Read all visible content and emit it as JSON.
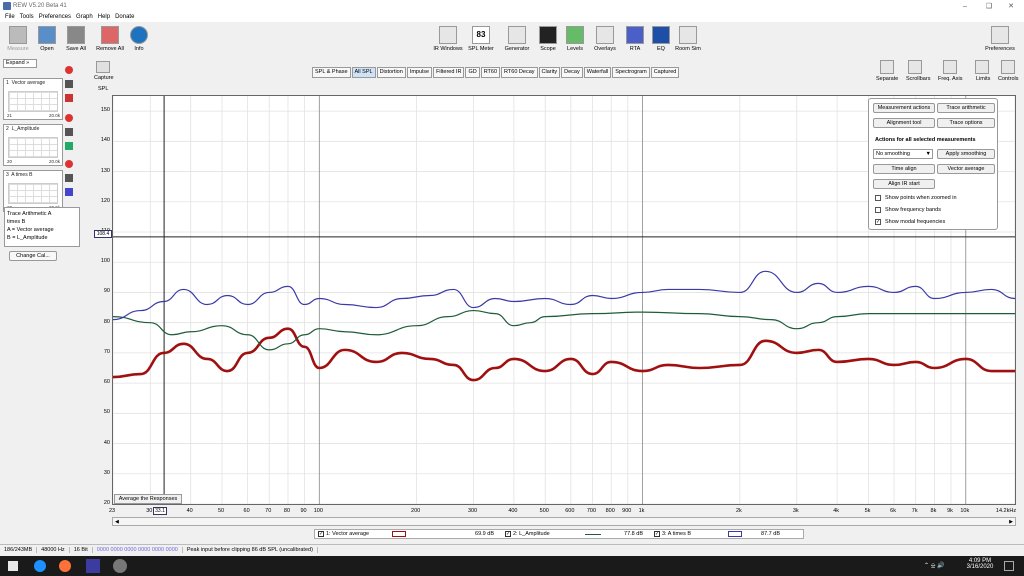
{
  "window": {
    "title": "REW V5.20 Beta 41"
  },
  "menu": [
    "File",
    "Tools",
    "Preferences",
    "Graph",
    "Help",
    "Donate"
  ],
  "toolbar": {
    "left": [
      "Measure",
      "Open",
      "Save All",
      "Remove All",
      "Info"
    ],
    "center": [
      "IR Windows",
      "SPL Meter",
      "Generator",
      "Scope",
      "Levels",
      "Overlays",
      "RTA",
      "EQ",
      "Room Sim"
    ],
    "spl_value": "83",
    "spl_tag": "dB SPL",
    "right": "Preferences"
  },
  "left_panel": {
    "expand": "Expand",
    "measurements": [
      {
        "num": "1",
        "name": "Vector average",
        "axis_left": "21",
        "axis_right": "20.0k"
      },
      {
        "num": "2",
        "name": "L_Amplitude",
        "axis_left": "20",
        "axis_right": "20.0k"
      },
      {
        "num": "3",
        "name": "A times B",
        "axis_left": "20",
        "axis_right": "20.0k"
      }
    ],
    "notes": [
      "Trace Arithmetic A",
      "times B",
      "A = Vector average",
      "B = L_Amplitude"
    ],
    "change_cal": "Change Cal..."
  },
  "capture": "Capture",
  "spl_axis_title": "SPL",
  "graph_tabs": [
    "SPL & Phase",
    "All SPL",
    "Distortion",
    "Impulse",
    "Filtered IR",
    "GD",
    "RT60",
    "RT60 Decay",
    "Clarity",
    "Decay",
    "Waterfall",
    "Spectrogram",
    "Captured"
  ],
  "active_tab": "All SPL",
  "right_tools": [
    "Separate",
    "Scrollbars",
    "Freq. Axis",
    "Limits",
    "Controls"
  ],
  "actions_panel": {
    "btn_measurement_actions": "Measurement actions",
    "btn_trace_arithmetic": "Trace arithmetic",
    "btn_alignment_tool": "Alignment tool",
    "btn_trace_options": "Trace options",
    "header": "Actions for all selected measurements",
    "smoothing_value": "No smoothing",
    "btn_apply_smoothing": "Apply smoothing",
    "btn_time_align": "Time align",
    "btn_vector_average": "Vector average",
    "btn_align_ir": "Align IR start",
    "chk_points": "Show points when zoomed in",
    "chk_bands": "Show frequency bands",
    "chk_modal": "Show modal frequencies"
  },
  "cursor": {
    "y_readout": "108.4",
    "x_readout": "33.1"
  },
  "avg_button": "Average the Responses",
  "legend": [
    {
      "label": "1: Vector average",
      "value": "69.9 dB",
      "color": "#a01010"
    },
    {
      "label": "2: L_Amplitude",
      "value": "77.8 dB",
      "color": "#1e5c3a"
    },
    {
      "label": "3: A times B",
      "value": "87.7 dB",
      "color": "#3a3aa8"
    }
  ],
  "status": [
    "186/243MB",
    "48000 Hz",
    "16 Bit",
    "0000 0000 0000 0000 0000 0000",
    "Peak input before clipping 86 dB SPL (uncalibrated)"
  ],
  "clock": {
    "time": "4:09 PM",
    "date": "3/16/2020"
  },
  "chart_data": {
    "type": "line",
    "xscale": "log",
    "xlim": [
      23,
      14200
    ],
    "ylim": [
      20,
      155
    ],
    "x_ticks": [
      "23",
      "30",
      "33.1",
      "40",
      "50",
      "60",
      "70",
      "80",
      "90",
      "100",
      "200",
      "300",
      "400",
      "500",
      "600",
      "700",
      "800",
      "900",
      "1k",
      "2k",
      "3k",
      "4k",
      "5k",
      "6k",
      "7k",
      "8k",
      "9k",
      "10k",
      "14.2kHz"
    ],
    "y_ticks": [
      150,
      140,
      130,
      120,
      110,
      100,
      90,
      80,
      70,
      60,
      50,
      40,
      30,
      20
    ],
    "series": [
      {
        "name": "1: Vector average",
        "color": "#a01010",
        "x": [
          23,
          28,
          33,
          38,
          45,
          52,
          60,
          70,
          80,
          90,
          100,
          120,
          150,
          180,
          220,
          260,
          300,
          350,
          400,
          500,
          600,
          700,
          800,
          1000,
          1200,
          1500,
          2000,
          2400,
          3000,
          3500,
          4000,
          5000,
          6000,
          7000,
          8000,
          10000,
          12000,
          14200
        ],
        "y": [
          62,
          63,
          70,
          73,
          68,
          64,
          70,
          75,
          78,
          72,
          65,
          71,
          67,
          70,
          68,
          66,
          61,
          65,
          68,
          64,
          68,
          63,
          67,
          64,
          66,
          65,
          66,
          74,
          70,
          71,
          67,
          68,
          66,
          67,
          65,
          68,
          64,
          64
        ]
      },
      {
        "name": "2: L_Amplitude",
        "color": "#1e5c3a",
        "x": [
          23,
          30,
          35,
          40,
          50,
          60,
          70,
          80,
          90,
          100,
          120,
          150,
          200,
          250,
          300,
          350,
          400,
          450,
          500,
          700,
          1000,
          1500,
          2000,
          2500,
          3000,
          3500,
          4000,
          5000,
          7000,
          10000,
          14200
        ],
        "y": [
          82,
          80,
          76,
          77,
          79,
          76,
          71,
          73,
          76,
          78,
          77,
          76,
          79,
          82,
          84,
          83,
          79,
          80,
          82,
          83,
          83.5,
          83,
          82,
          81,
          78,
          80,
          82,
          83,
          83,
          83,
          83
        ]
      },
      {
        "name": "3: A times B",
        "color": "#3a3aa8",
        "x": [
          23,
          28,
          33,
          38,
          45,
          52,
          60,
          70,
          80,
          90,
          100,
          120,
          150,
          180,
          220,
          260,
          300,
          350,
          400,
          500,
          600,
          700,
          800,
          1000,
          1200,
          1500,
          2000,
          2400,
          3000,
          3500,
          4000,
          5000,
          6000,
          7000,
          8000,
          10000,
          12000,
          14200
        ],
        "y": [
          81,
          84,
          87,
          91,
          86,
          89,
          86,
          90,
          92,
          86,
          88,
          86,
          85,
          88,
          89,
          91,
          85,
          88,
          87,
          88,
          86,
          89,
          88,
          90,
          91,
          91,
          90,
          97,
          90,
          93,
          90,
          92,
          90,
          92,
          88,
          90,
          91,
          88
        ]
      }
    ]
  }
}
